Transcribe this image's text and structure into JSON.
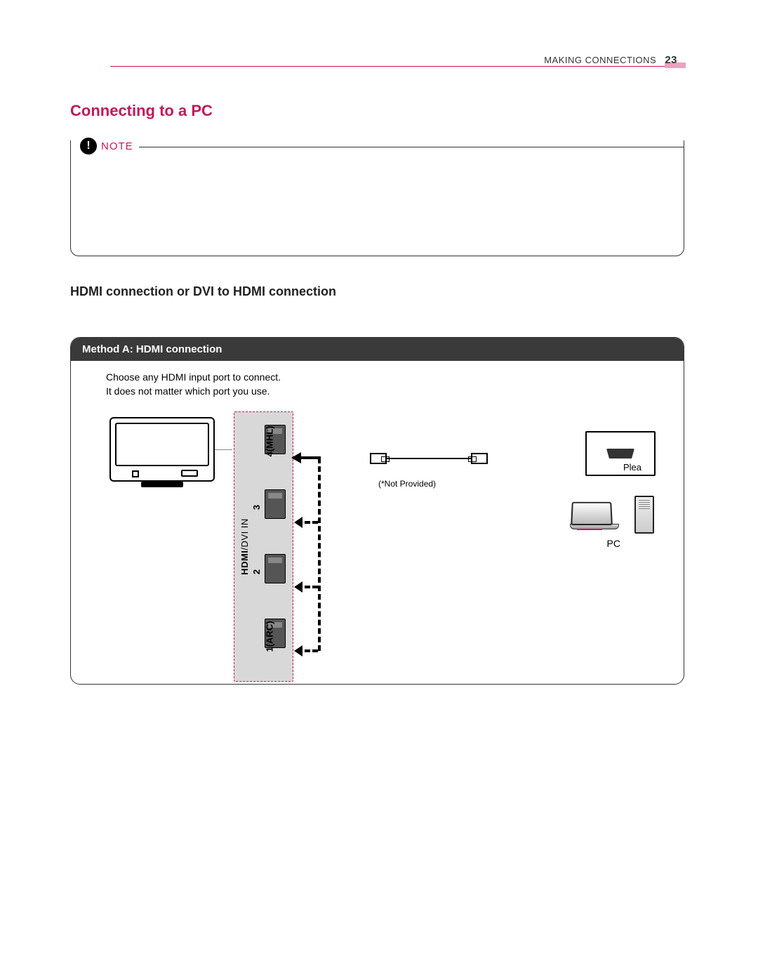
{
  "header": {
    "section": "MAKING CONNECTIONS",
    "page_number": "23"
  },
  "title": "Connecting to a PC",
  "note": {
    "label": "NOTE",
    "icon_glyph": "!"
  },
  "subheading": "HDMI connection or DVI to HDMI connection",
  "method": {
    "header": "Method A: HDMI connection",
    "instructions": [
      "Choose any HDMI input port to connect.",
      "It does not matter which port you use."
    ],
    "panel_label_main": "HDMI",
    "panel_label_sub": "/DVI IN",
    "ports": [
      {
        "label": "4(MHL)"
      },
      {
        "label": "3"
      },
      {
        "label": "2"
      },
      {
        "label": "1(ARC)"
      }
    ],
    "cable_note": "(*Not Provided)",
    "right_box_text": "Plea",
    "pc_label": "PC"
  }
}
